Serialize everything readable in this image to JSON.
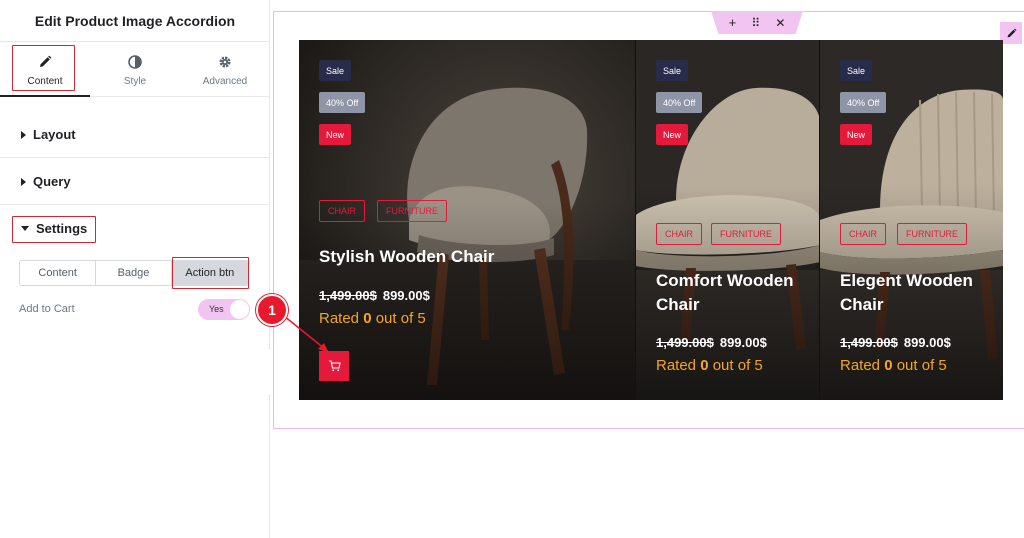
{
  "panel": {
    "title": "Edit Product Image Accordion",
    "tabs": [
      {
        "label": "Content",
        "icon": "pencil-icon"
      },
      {
        "label": "Style",
        "icon": "half-circle-icon"
      },
      {
        "label": "Advanced",
        "icon": "gear-icon"
      }
    ],
    "sections": {
      "layout": "Layout",
      "query": "Query",
      "settings": "Settings"
    },
    "settings_tabs": [
      "Content",
      "Badge",
      "Action btn"
    ],
    "add_to_cart": {
      "label": "Add to Cart",
      "toggle_text": "Yes"
    },
    "collapse_icon": "‹"
  },
  "canvas": {
    "toolbar": {
      "add": "+",
      "move": "⠿",
      "close": "✕"
    },
    "products": [
      {
        "badges": {
          "sale": "Sale",
          "off": "40% Off",
          "new": "New"
        },
        "categories": [
          "CHAIR",
          "FURNITURE"
        ],
        "title_line1": "Stylish Wooden Chair",
        "title_line2": "",
        "old_price": "1,499.00$",
        "new_price": "899.00$",
        "rating_prefix": "Rated ",
        "rating_value": "0",
        "rating_suffix": " out of 5"
      },
      {
        "badges": {
          "sale": "Sale",
          "off": "40% Off",
          "new": "New"
        },
        "categories": [
          "CHAIR",
          "FURNITURE"
        ],
        "title_line1": "Comfort Wooden",
        "title_line2": "Chair",
        "old_price": "1,499.00$",
        "new_price": "899.00$",
        "rating_prefix": "Rated ",
        "rating_value": "0",
        "rating_suffix": " out of 5"
      },
      {
        "badges": {
          "sale": "Sale",
          "off": "40% Off",
          "new": "New"
        },
        "categories": [
          "CHAIR",
          "FURNITURE"
        ],
        "title_line1": "Elegent Wooden",
        "title_line2": "Chair",
        "old_price": "1,499.00$",
        "new_price": "899.00$",
        "rating_prefix": "Rated ",
        "rating_value": "0",
        "rating_suffix": " out of 5"
      }
    ],
    "marker_number": "1"
  },
  "colors": {
    "accent_red": "#e4193b",
    "highlight_pink": "#f1c4f2",
    "rating_orange": "#f5a623"
  }
}
